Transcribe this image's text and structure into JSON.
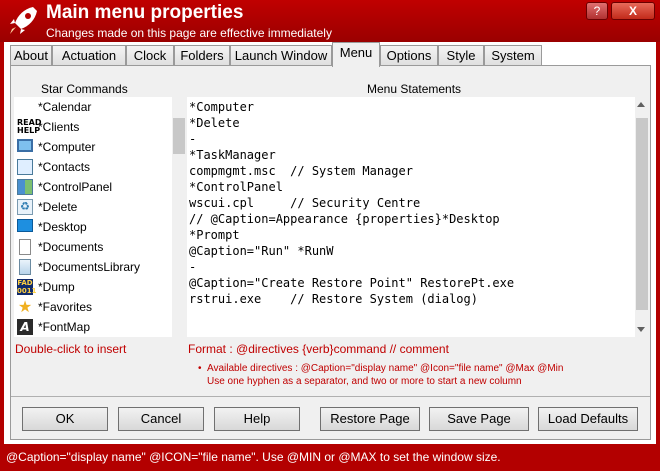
{
  "window": {
    "title": "Main menu properties",
    "subtitle": "Changes made on this page are effective immediately",
    "help_button": "?",
    "close_button": "X"
  },
  "tabs": [
    {
      "label": "About"
    },
    {
      "label": "Actuation"
    },
    {
      "label": "Clock"
    },
    {
      "label": "Folders"
    },
    {
      "label": "Launch Window"
    },
    {
      "label": "Menu",
      "active": true
    },
    {
      "label": "Options"
    },
    {
      "label": "Style"
    },
    {
      "label": "System"
    }
  ],
  "star_commands": {
    "header": "Star Commands",
    "items": [
      {
        "label": "*Calendar",
        "icon": "none"
      },
      {
        "label": "*Clients",
        "icon": "readme-icon"
      },
      {
        "label": "*Computer",
        "icon": "computer-icon"
      },
      {
        "label": "*Contacts",
        "icon": "contacts-icon"
      },
      {
        "label": "*ControlPanel",
        "icon": "control-panel-icon"
      },
      {
        "label": "*Delete",
        "icon": "recycle-icon"
      },
      {
        "label": "*Desktop",
        "icon": "desktop-icon"
      },
      {
        "label": "*Documents",
        "icon": "document-icon"
      },
      {
        "label": "*DocumentsLibrary",
        "icon": "library-icon"
      },
      {
        "label": "*Dump",
        "icon": "dump-icon"
      },
      {
        "label": "*Favorites",
        "icon": "star-icon"
      },
      {
        "label": "*FontMap",
        "icon": "font-icon"
      }
    ],
    "hint": "Double-click to insert"
  },
  "menu_statements": {
    "header": "Menu Statements",
    "lines": [
      "*Computer",
      "*Delete",
      "-",
      "*TaskManager",
      "compmgmt.msc  // System Manager",
      "*ControlPanel",
      "wscui.cpl     // Security Centre",
      "// @Caption=Appearance {properties}*Desktop",
      "*Prompt",
      "@Caption=\"Run\" *RunW",
      "-",
      "@Caption=\"Create Restore Point\" RestorePt.exe",
      "rstrui.exe    // Restore System (dialog)"
    ]
  },
  "format": {
    "text": "Format : @directives {verb}command // comment",
    "note1": "Available directives : @Caption=\"display name\" @Icon=\"file name\" @Max @Min",
    "note2": "Use one hyphen as a separator, and two or more to start a new column"
  },
  "buttons": {
    "ok": "OK",
    "cancel": "Cancel",
    "help": "Help",
    "restore": "Restore Page",
    "save": "Save Page",
    "defaults": "Load Defaults"
  },
  "status": "@Caption=\"display name\" @ICON=\"file name\". Use @MIN or @MAX to set the window size.",
  "colors": {
    "frame": "#b30000",
    "accent_text": "#c00000",
    "panel": "#f0f0f0"
  }
}
